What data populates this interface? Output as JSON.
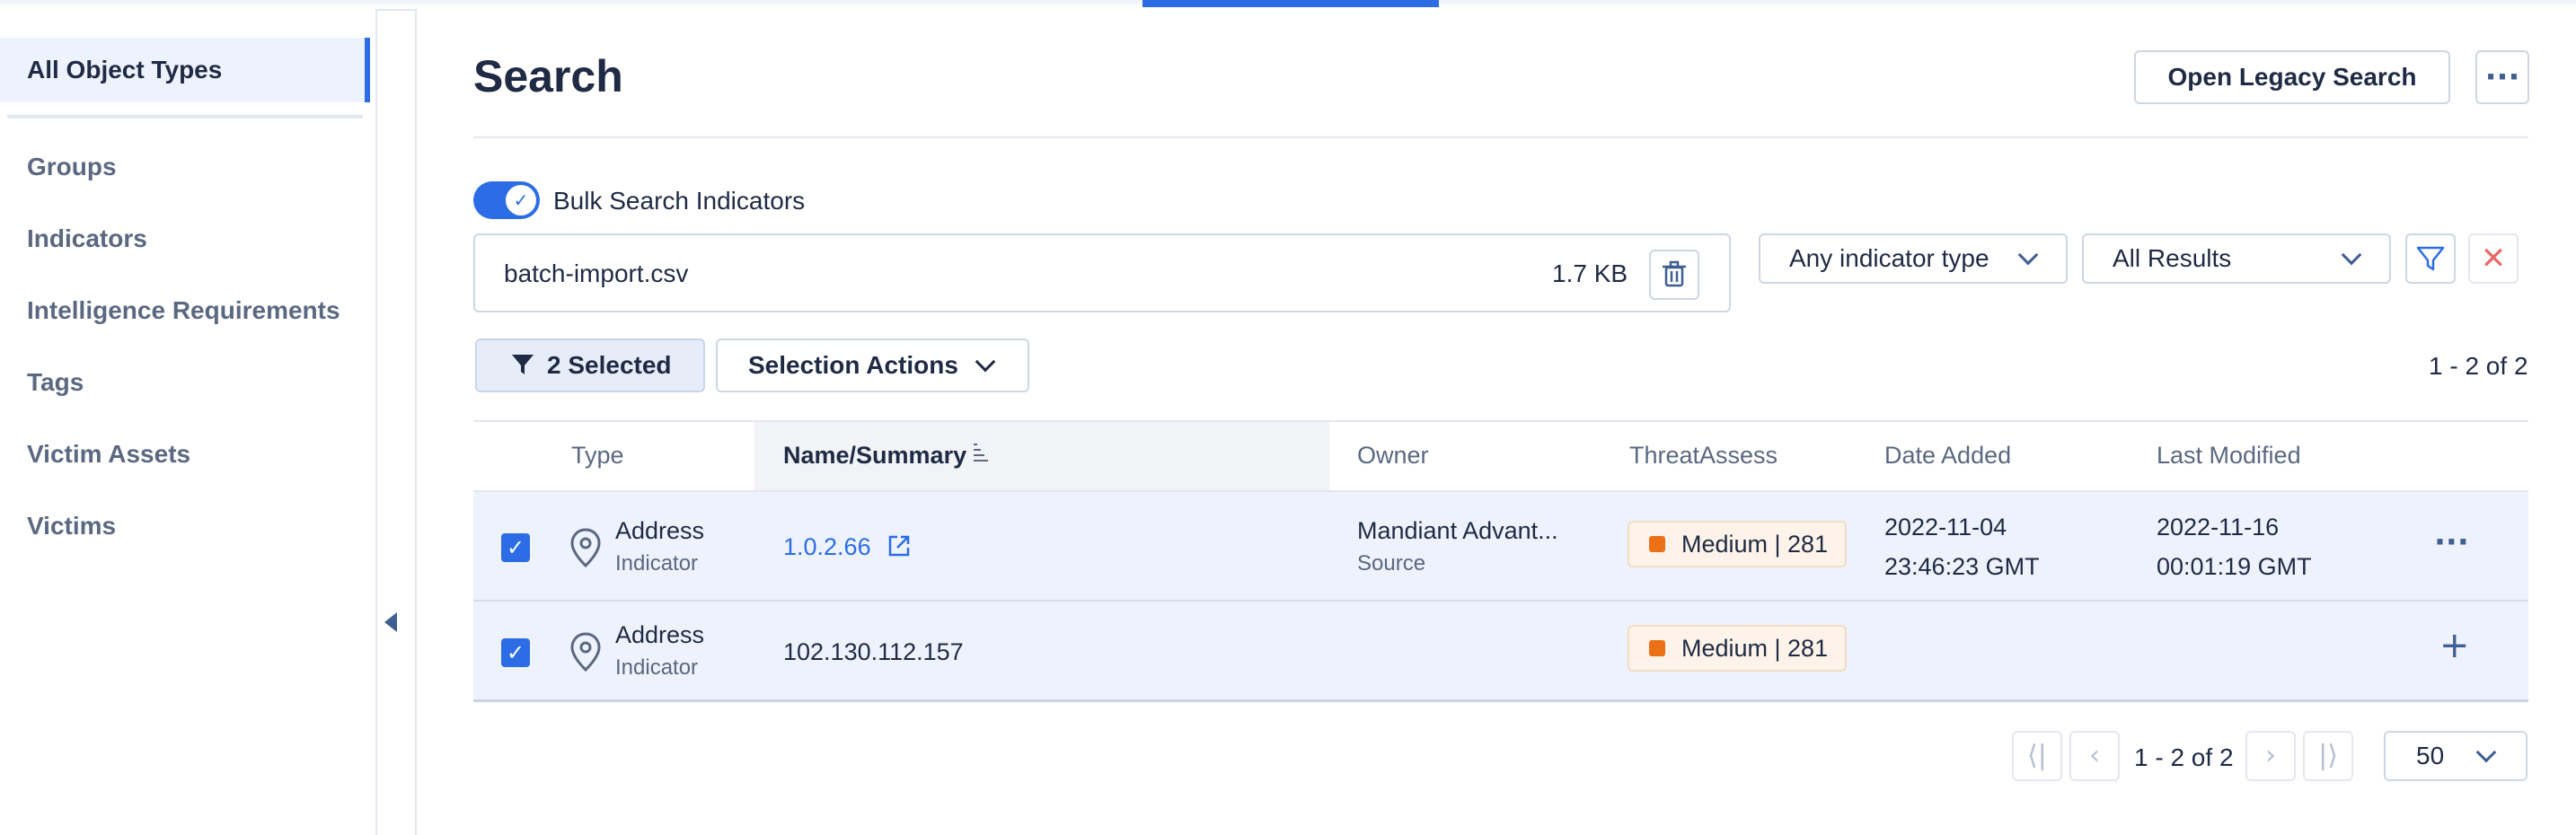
{
  "sidebar": {
    "active": "All Object Types",
    "items": [
      "Groups",
      "Indicators",
      "Intelligence Requirements",
      "Tags",
      "Victim Assets",
      "Victims"
    ]
  },
  "header": {
    "title": "Search",
    "legacy_button": "Open Legacy Search",
    "more_icon": "more-horizontal-icon"
  },
  "bulk": {
    "toggle_label": "Bulk Search Indicators",
    "toggle_on": true,
    "file_name": "batch-import.csv",
    "file_size": "1.7 KB"
  },
  "filters": {
    "indicator_type": "Any indicator type",
    "results": "All Results"
  },
  "selection": {
    "selected_label": "2 Selected",
    "actions_label": "Selection Actions",
    "range": "1 - 2 of 2"
  },
  "table": {
    "columns": [
      "Type",
      "Name/Summary",
      "Owner",
      "ThreatAssess",
      "Date Added",
      "Last Modified"
    ],
    "rows": [
      {
        "type": "Address",
        "type_sub": "Indicator",
        "name": "1.0.2.66",
        "owner": "Mandiant Advant...",
        "owner_sub": "Source",
        "threat": "Medium | 281",
        "date_added_1": "2022-11-04",
        "date_added_2": "23:46:23 GMT",
        "modified_1": "2022-11-16",
        "modified_2": "00:01:19 GMT"
      },
      {
        "type": "Address",
        "type_sub": "Indicator",
        "name": "102.130.112.157",
        "threat": "Medium | 281"
      }
    ]
  },
  "pagination": {
    "text": "1 - 2 of 2",
    "page_size": "50"
  },
  "colors": {
    "accent": "#2c6de6",
    "threat_medium": "#ec7116"
  }
}
